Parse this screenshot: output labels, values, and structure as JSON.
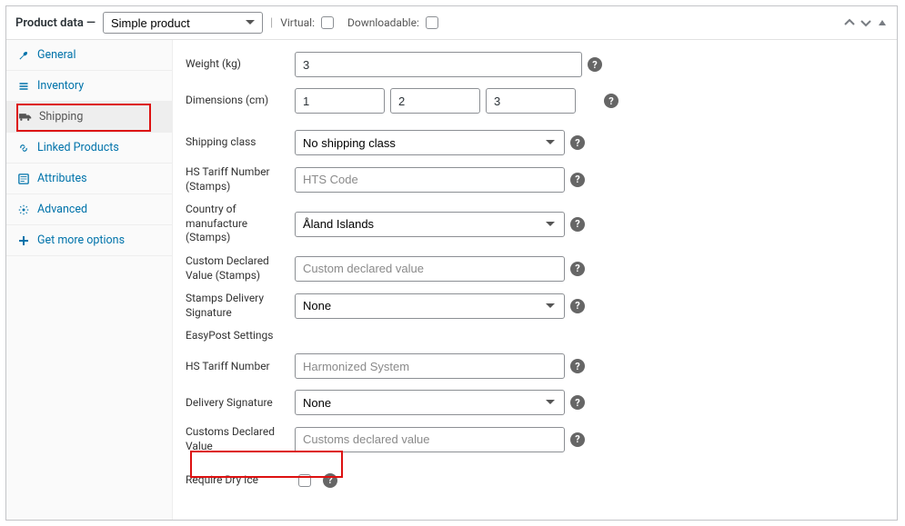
{
  "header": {
    "title": "Product data —",
    "type_options": [
      "Simple product"
    ],
    "type_value": "Simple product",
    "virtual_label": "Virtual:",
    "downloadable_label": "Downloadable:"
  },
  "tabs": [
    {
      "key": "general",
      "label": "General",
      "icon": "wrench"
    },
    {
      "key": "inventory",
      "label": "Inventory",
      "icon": "list"
    },
    {
      "key": "shipping",
      "label": "Shipping",
      "icon": "truck",
      "active": true
    },
    {
      "key": "linked",
      "label": "Linked Products",
      "icon": "link"
    },
    {
      "key": "attributes",
      "label": "Attributes",
      "icon": "note"
    },
    {
      "key": "advanced",
      "label": "Advanced",
      "icon": "gear"
    },
    {
      "key": "more",
      "label": "Get more options",
      "icon": "plus"
    }
  ],
  "fields": {
    "weight_label": "Weight (kg)",
    "weight_value": "3",
    "dimensions_label": "Dimensions (cm)",
    "dim_l": "1",
    "dim_w": "2",
    "dim_h": "3",
    "shipping_class_label": "Shipping class",
    "shipping_class_value": "No shipping class",
    "hts_label": "HS Tariff Number (Stamps)",
    "hts_placeholder": "HTS Code",
    "country_label": "Country of manufacture (Stamps)",
    "country_value": "Åland Islands",
    "custom_declared_label": "Custom Declared Value (Stamps)",
    "custom_declared_placeholder": "Custom declared value",
    "stamps_signature_label": "Stamps Delivery Signature",
    "stamps_signature_value": "None",
    "easypost_heading": "EasyPost Settings",
    "ep_hts_label": "HS Tariff Number",
    "ep_hts_placeholder": "Harmonized System",
    "ep_signature_label": "Delivery Signature",
    "ep_signature_value": "None",
    "ep_declared_label": "Customs Declared Value",
    "ep_declared_placeholder": "Customs declared value",
    "dry_ice_label": "Require Dry Ice"
  }
}
